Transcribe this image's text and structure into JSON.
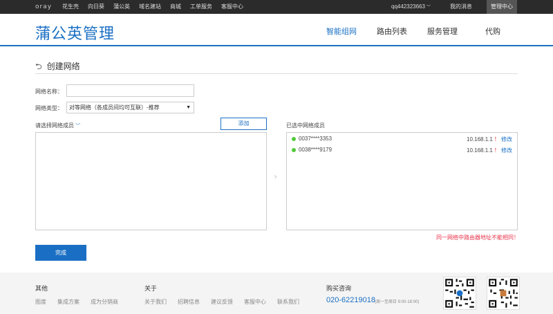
{
  "topbar": {
    "logo": "oray",
    "nav": [
      "花生壳",
      "向日葵",
      "蒲公英",
      "域名建站",
      "商城",
      "工单服务",
      "客服中心"
    ],
    "user": "qq442323663",
    "messages": "我的消息",
    "admin": "管理中心"
  },
  "header": {
    "brand": "蒲公英管理",
    "nav": [
      "智能组网",
      "路由列表",
      "服务管理",
      "代购"
    ],
    "active": "智能组网",
    "accent_color": "#1a6fc4"
  },
  "page": {
    "title": "创建网络",
    "name_label": "网络名称：",
    "name_value": "",
    "type_label": "网络类型：",
    "type_selected": "对等网络（各成员间均可互联）-推荐",
    "select_members_label": "请选择网络成员",
    "add_button": "添加",
    "selected_members_label": "已选中网络成员",
    "members": [
      {
        "id": "0037****3353",
        "ip": "10.168.1.1",
        "warn": "！",
        "edit": "修改"
      },
      {
        "id": "0038****9179",
        "ip": "10.168.1.1",
        "warn": "！",
        "edit": "修改"
      }
    ],
    "error_note": "同一网络中路由器地址不能相同！",
    "done_button": "完成"
  },
  "footer": {
    "other_title": "其他",
    "other_links": [
      "图度",
      "集成方案",
      "成为分销商"
    ],
    "about_title": "关于",
    "about_links": [
      "关于我们",
      "招聘信息",
      "建议反馈",
      "客服中心",
      "联系我们"
    ],
    "buy_title": "购买咨询",
    "phone": "020-62219018",
    "hours": "(周一至周日 9:00-18:00)"
  }
}
